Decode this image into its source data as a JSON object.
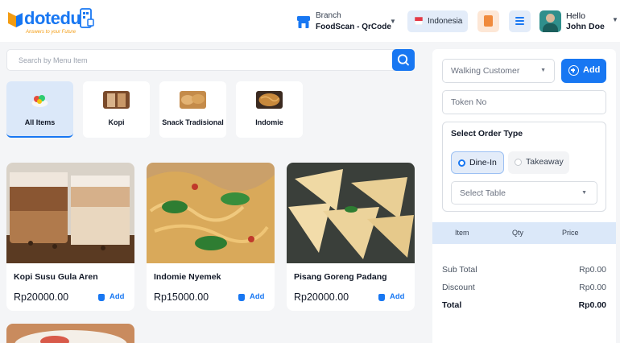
{
  "brand": {
    "name": "dotedu",
    "tagline": "Answers to your Future",
    "accent": "#1877f2"
  },
  "header": {
    "branch_label": "Branch",
    "branch_value": "FoodScan - QrCode",
    "language": "Indonesia",
    "greeting": "Hello",
    "user_name": "John Doe"
  },
  "search": {
    "placeholder": "Search by Menu Item"
  },
  "categories": [
    {
      "label": "All Items",
      "active": true
    },
    {
      "label": "Kopi",
      "active": false
    },
    {
      "label": "Snack Tradisional",
      "active": false
    },
    {
      "label": "Indomie",
      "active": false
    }
  ],
  "products": [
    {
      "name": "Kopi Susu Gula Aren",
      "price": "Rp20000.00",
      "add_label": "Add"
    },
    {
      "name": "Indomie Nyemek",
      "price": "Rp15000.00",
      "add_label": "Add"
    },
    {
      "name": "Pisang Goreng Padang",
      "price": "Rp20000.00",
      "add_label": "Add"
    }
  ],
  "order": {
    "customer": "Walking Customer",
    "add_label": "Add",
    "token_placeholder": "Token No",
    "order_type_title": "Select Order Type",
    "order_types": [
      {
        "label": "Dine-In",
        "selected": true
      },
      {
        "label": "Takeaway",
        "selected": false
      }
    ],
    "table_placeholder": "Select Table",
    "columns": [
      "Item",
      "Qty",
      "Price"
    ],
    "summary": [
      {
        "label": "Sub Total",
        "value": "Rp0.00"
      },
      {
        "label": "Discount",
        "value": "Rp0.00"
      },
      {
        "label": "Total",
        "value": "Rp0.00"
      }
    ]
  }
}
